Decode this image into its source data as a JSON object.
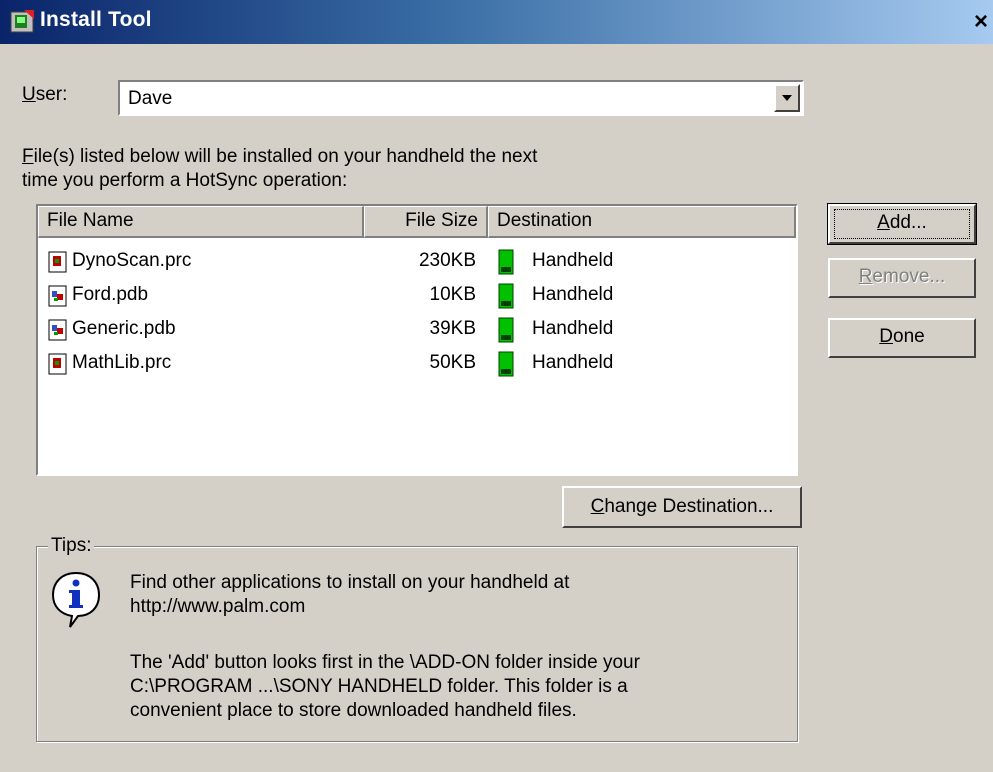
{
  "window": {
    "title": "Install Tool",
    "close_glyph": "×"
  },
  "user": {
    "label": "User:",
    "label_mnemonic": "U",
    "label_rest": "ser:",
    "selected": "Dave"
  },
  "description": {
    "line1_mnemonic": "F",
    "line1_rest": "ile(s) listed below will be installed on your handheld the next",
    "line2": "time you perform a HotSync operation:"
  },
  "table": {
    "columns": [
      "File Name",
      "File Size",
      "Destination"
    ],
    "rows": [
      {
        "name": "DynoScan.prc",
        "size": "230KB",
        "destination": "Handheld",
        "icon": "prc-file-icon"
      },
      {
        "name": "Ford.pdb",
        "size": "10KB",
        "destination": "Handheld",
        "icon": "pdb-file-icon"
      },
      {
        "name": "Generic.pdb",
        "size": "39KB",
        "destination": "Handheld",
        "icon": "pdb-file-icon"
      },
      {
        "name": "MathLib.prc",
        "size": "50KB",
        "destination": "Handheld",
        "icon": "prc-file-icon"
      }
    ]
  },
  "buttons": {
    "add": {
      "mnemonic": "A",
      "rest": "dd..."
    },
    "remove": {
      "mnemonic": "R",
      "rest": "emove..."
    },
    "done": {
      "mnemonic": "D",
      "rest": "one"
    },
    "change_destination": {
      "mnemonic": "C",
      "rest": "hange Destination..."
    }
  },
  "tips": {
    "legend": "Tips:",
    "line1": "Find other applications to install on your handheld at",
    "line2": "http://www.palm.com",
    "line3": "The 'Add' button looks first in the \\ADD-ON folder inside your",
    "line4": "C:\\PROGRAM ...\\SONY HANDHELD folder. This folder is a",
    "line5": "convenient place to store downloaded handheld files."
  },
  "colors": {
    "title_gradient_start": "#0a246a",
    "title_gradient_end": "#a6caf0",
    "face": "#d4d0c8",
    "handheld_green": "#00c000"
  }
}
